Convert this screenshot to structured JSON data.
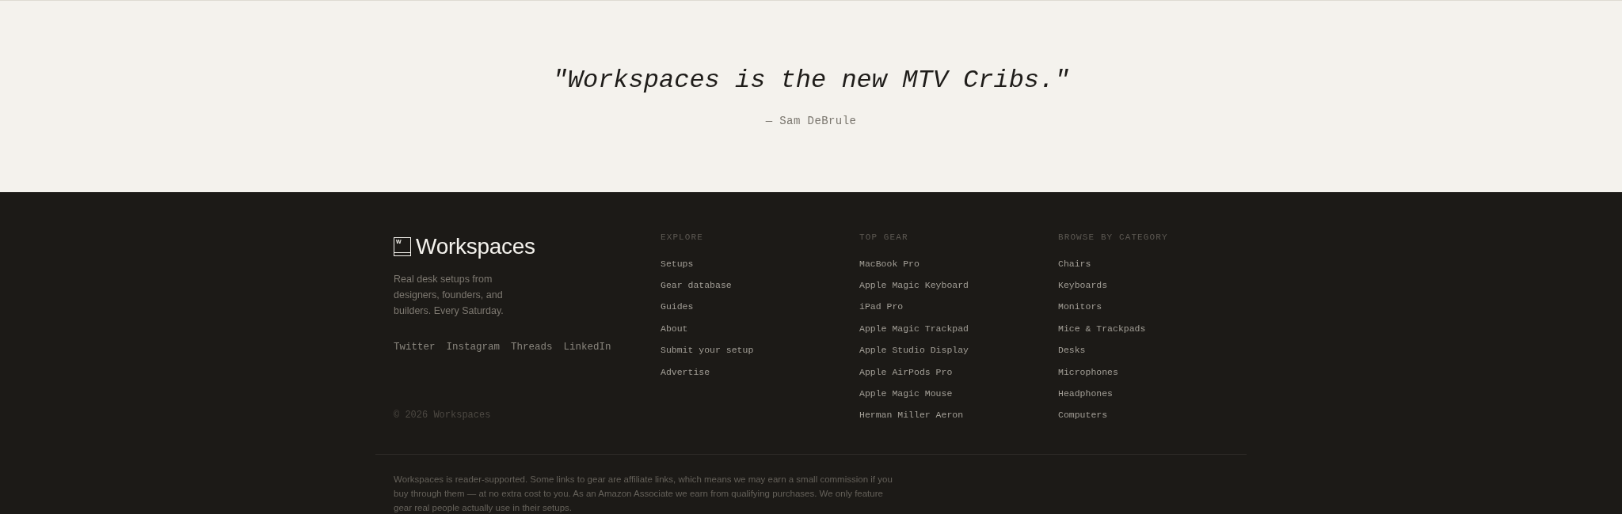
{
  "testimonial": {
    "quote": "\"Workspaces is the new MTV Cribs.\"",
    "author": "— Sam DeBrule"
  },
  "footer": {
    "brand": {
      "mark": "W",
      "name": "Workspaces"
    },
    "description": "Real desk setups from designers, founders, and builders. Every Saturday.",
    "social_links": [
      "Twitter",
      "Instagram",
      "Threads",
      "LinkedIn"
    ],
    "copyright": "© 2026 Workspaces",
    "columns": [
      {
        "heading": "EXPLORE",
        "links": [
          "Setups",
          "Gear database",
          "Guides",
          "About",
          "Submit your setup",
          "Advertise"
        ]
      },
      {
        "heading": "TOP GEAR",
        "links": [
          "MacBook Pro",
          "Apple Magic Keyboard",
          "iPad Pro",
          "Apple Magic Trackpad",
          "Apple Studio Display",
          "Apple AirPods Pro",
          "Apple Magic Mouse",
          "Herman Miller Aeron"
        ]
      },
      {
        "heading": "BROWSE BY CATEGORY",
        "links": [
          "Chairs",
          "Keyboards",
          "Monitors",
          "Mice & Trackpads",
          "Desks",
          "Microphones",
          "Headphones",
          "Computers"
        ]
      }
    ],
    "disclaimer": "Workspaces is reader-supported. Some links to gear are affiliate links, which means we may earn a small commission if you buy through them — at no extra cost to you. As an Amazon Associate we earn from qualifying purchases. We only feature gear real people actually use in their setups."
  }
}
